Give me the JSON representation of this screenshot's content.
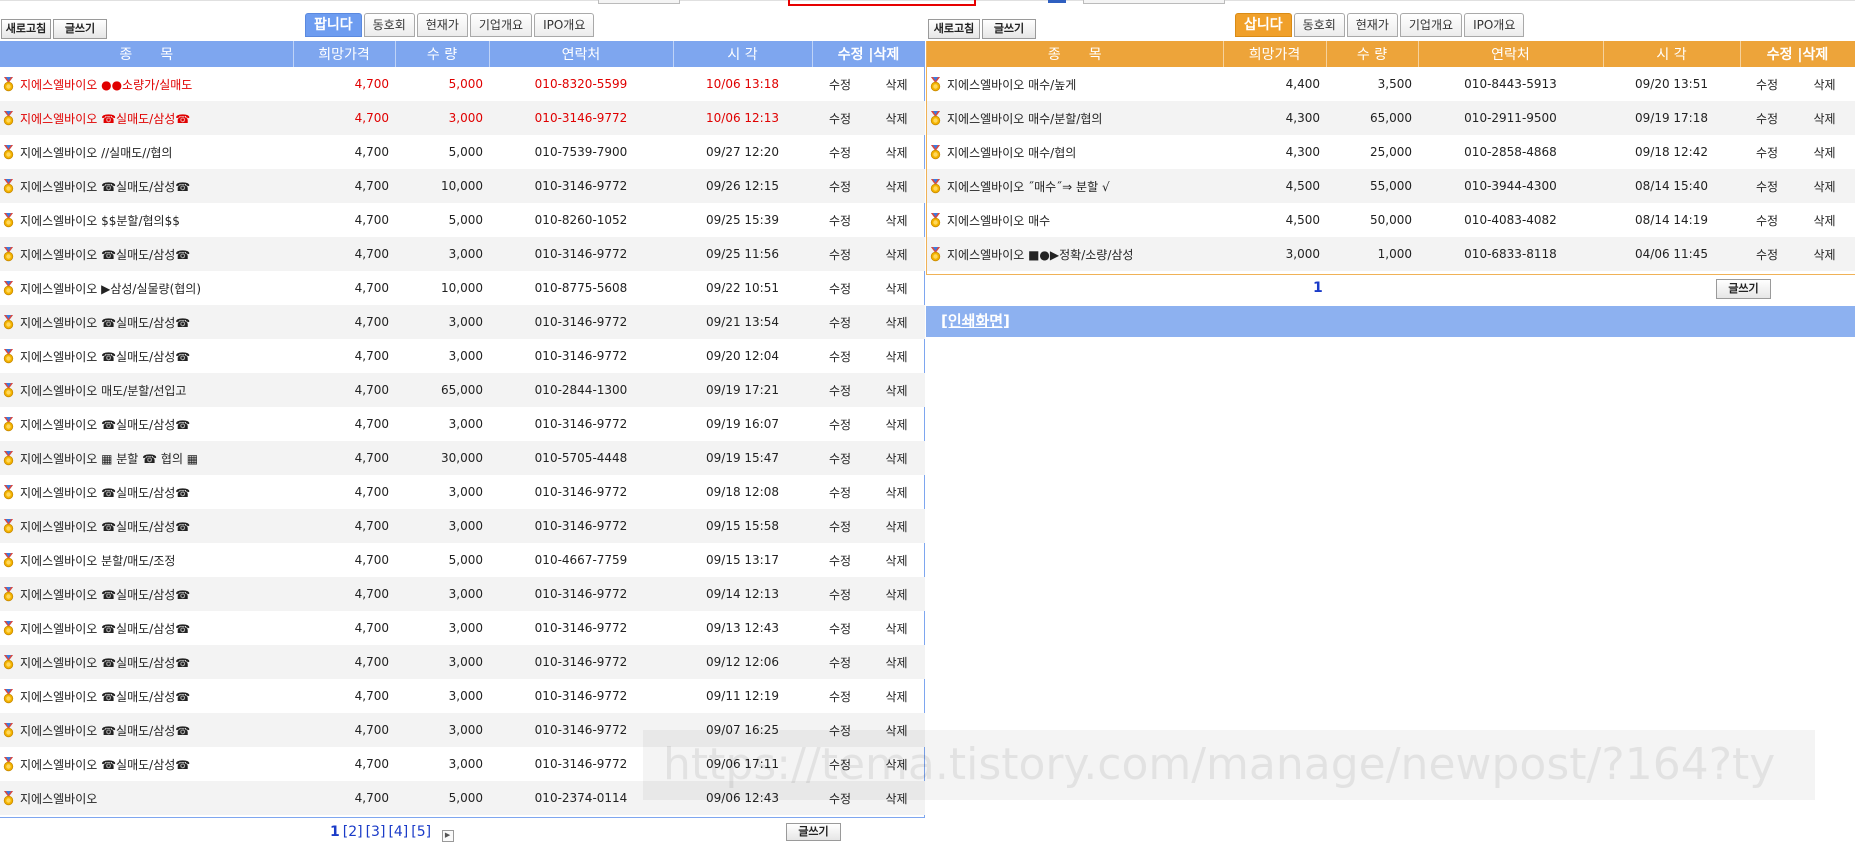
{
  "toolbar_left": {
    "refresh": "새로고침",
    "write": "글쓰기"
  },
  "toolbar_right": {
    "refresh": "새로고침",
    "write": "글쓰기"
  },
  "tabs_left": [
    {
      "label": "팝니다",
      "active": true
    },
    {
      "label": "동호회",
      "active": false
    },
    {
      "label": "현재가",
      "active": false
    },
    {
      "label": "기업개요",
      "active": false
    },
    {
      "label": "IPO개요",
      "active": false
    }
  ],
  "tabs_right": [
    {
      "label": "삽니다",
      "active": true
    },
    {
      "label": "동호회",
      "active": false
    },
    {
      "label": "현재가",
      "active": false
    },
    {
      "label": "기업개요",
      "active": false
    },
    {
      "label": "IPO개요",
      "active": false
    }
  ],
  "columns": {
    "item": "종　　목",
    "price": "희망가격",
    "qty": "수 량",
    "contact": "연락처",
    "time": "시 각",
    "actions": "수정 |삭제"
  },
  "sell_rows": [
    {
      "name": "지에스엘바이오 ●●소량가/실매도",
      "price": "4,700",
      "qty": "5,000",
      "contact": "010-8320-5599",
      "time": "10/06 13:18",
      "highlight": true
    },
    {
      "name": "지에스엘바이오 ☎실매도/삼성☎",
      "price": "4,700",
      "qty": "3,000",
      "contact": "010-3146-9772",
      "time": "10/06 12:13",
      "highlight": true
    },
    {
      "name": "지에스엘바이오 //실매도//협의",
      "price": "4,700",
      "qty": "5,000",
      "contact": "010-7539-7900",
      "time": "09/27 12:20"
    },
    {
      "name": "지에스엘바이오 ☎실매도/삼성☎",
      "price": "4,700",
      "qty": "10,000",
      "contact": "010-3146-9772",
      "time": "09/26 12:15"
    },
    {
      "name": "지에스엘바이오 $$분할/협의$$",
      "price": "4,700",
      "qty": "5,000",
      "contact": "010-8260-1052",
      "time": "09/25 15:39"
    },
    {
      "name": "지에스엘바이오 ☎실매도/삼성☎",
      "price": "4,700",
      "qty": "3,000",
      "contact": "010-3146-9772",
      "time": "09/25 11:56"
    },
    {
      "name": "지에스엘바이오 ▶삼성/실물량(협의)",
      "price": "4,700",
      "qty": "10,000",
      "contact": "010-8775-5608",
      "time": "09/22 10:51"
    },
    {
      "name": "지에스엘바이오 ☎실매도/삼성☎",
      "price": "4,700",
      "qty": "3,000",
      "contact": "010-3146-9772",
      "time": "09/21 13:54"
    },
    {
      "name": "지에스엘바이오 ☎실매도/삼성☎",
      "price": "4,700",
      "qty": "3,000",
      "contact": "010-3146-9772",
      "time": "09/20 12:04"
    },
    {
      "name": "지에스엘바이오 매도/분할/선입고",
      "price": "4,700",
      "qty": "65,000",
      "contact": "010-2844-1300",
      "time": "09/19 17:21"
    },
    {
      "name": "지에스엘바이오 ☎실매도/삼성☎",
      "price": "4,700",
      "qty": "3,000",
      "contact": "010-3146-9772",
      "time": "09/19 16:07"
    },
    {
      "name": "지에스엘바이오 ▦ 분할 ☎ 협의 ▦",
      "price": "4,700",
      "qty": "30,000",
      "contact": "010-5705-4448",
      "time": "09/19 15:47"
    },
    {
      "name": "지에스엘바이오 ☎실매도/삼성☎",
      "price": "4,700",
      "qty": "3,000",
      "contact": "010-3146-9772",
      "time": "09/18 12:08"
    },
    {
      "name": "지에스엘바이오 ☎실매도/삼성☎",
      "price": "4,700",
      "qty": "3,000",
      "contact": "010-3146-9772",
      "time": "09/15 15:58"
    },
    {
      "name": "지에스엘바이오 분할/매도/조정",
      "price": "4,700",
      "qty": "5,000",
      "contact": "010-4667-7759",
      "time": "09/15 13:17"
    },
    {
      "name": "지에스엘바이오 ☎실매도/삼성☎",
      "price": "4,700",
      "qty": "3,000",
      "contact": "010-3146-9772",
      "time": "09/14 12:13"
    },
    {
      "name": "지에스엘바이오 ☎실매도/삼성☎",
      "price": "4,700",
      "qty": "3,000",
      "contact": "010-3146-9772",
      "time": "09/13 12:43"
    },
    {
      "name": "지에스엘바이오 ☎실매도/삼성☎",
      "price": "4,700",
      "qty": "3,000",
      "contact": "010-3146-9772",
      "time": "09/12 12:06"
    },
    {
      "name": "지에스엘바이오 ☎실매도/삼성☎",
      "price": "4,700",
      "qty": "3,000",
      "contact": "010-3146-9772",
      "time": "09/11 12:19"
    },
    {
      "name": "지에스엘바이오 ☎실매도/삼성☎",
      "price": "4,700",
      "qty": "3,000",
      "contact": "010-3146-9772",
      "time": "09/07 16:25"
    },
    {
      "name": "지에스엘바이오 ☎실매도/삼성☎",
      "price": "4,700",
      "qty": "3,000",
      "contact": "010-3146-9772",
      "time": "09/06 17:11"
    },
    {
      "name": "지에스엘바이오",
      "price": "4,700",
      "qty": "5,000",
      "contact": "010-2374-0114",
      "time": "09/06 12:43"
    }
  ],
  "buy_rows": [
    {
      "name": "지에스엘바이오 매수/높게",
      "price": "4,400",
      "qty": "3,500",
      "contact": "010-8443-5913",
      "time": "09/20 13:51"
    },
    {
      "name": "지에스엘바이오 매수/분할/협의",
      "price": "4,300",
      "qty": "65,000",
      "contact": "010-2911-9500",
      "time": "09/19 17:18"
    },
    {
      "name": "지에스엘바이오 매수/협의",
      "price": "4,300",
      "qty": "25,000",
      "contact": "010-2858-4868",
      "time": "09/18 12:42"
    },
    {
      "name": "지에스엘바이오 ˝매수˝⇒ 분할 √",
      "price": "4,500",
      "qty": "55,000",
      "contact": "010-3944-4300",
      "time": "08/14 15:40"
    },
    {
      "name": "지에스엘바이오 매수",
      "price": "4,500",
      "qty": "50,000",
      "contact": "010-4083-4082",
      "time": "08/14 14:19"
    },
    {
      "name": "지에스엘바이오 ■●▶정확/소량/삼성",
      "price": "3,000",
      "qty": "1,000",
      "contact": "010-6833-8118",
      "time": "04/06 11:45"
    }
  ],
  "row_actions": {
    "edit": "수정",
    "delete": "삭제"
  },
  "pager_left": {
    "pages": [
      "1",
      "[2]",
      "[3]",
      "[4]",
      "[5]"
    ],
    "write": "글쓰기"
  },
  "pager_right": {
    "page": "1",
    "write": "글쓰기"
  },
  "print_link": "[인쇄화면]",
  "watermark": "https://tema.tistory.com/manage/newpost/?164?ty",
  "colors": {
    "sell_header": "#7ea6ef",
    "buy_header": "#eda43a",
    "highlight_text": "#e00000",
    "link": "#1a3bc8"
  }
}
